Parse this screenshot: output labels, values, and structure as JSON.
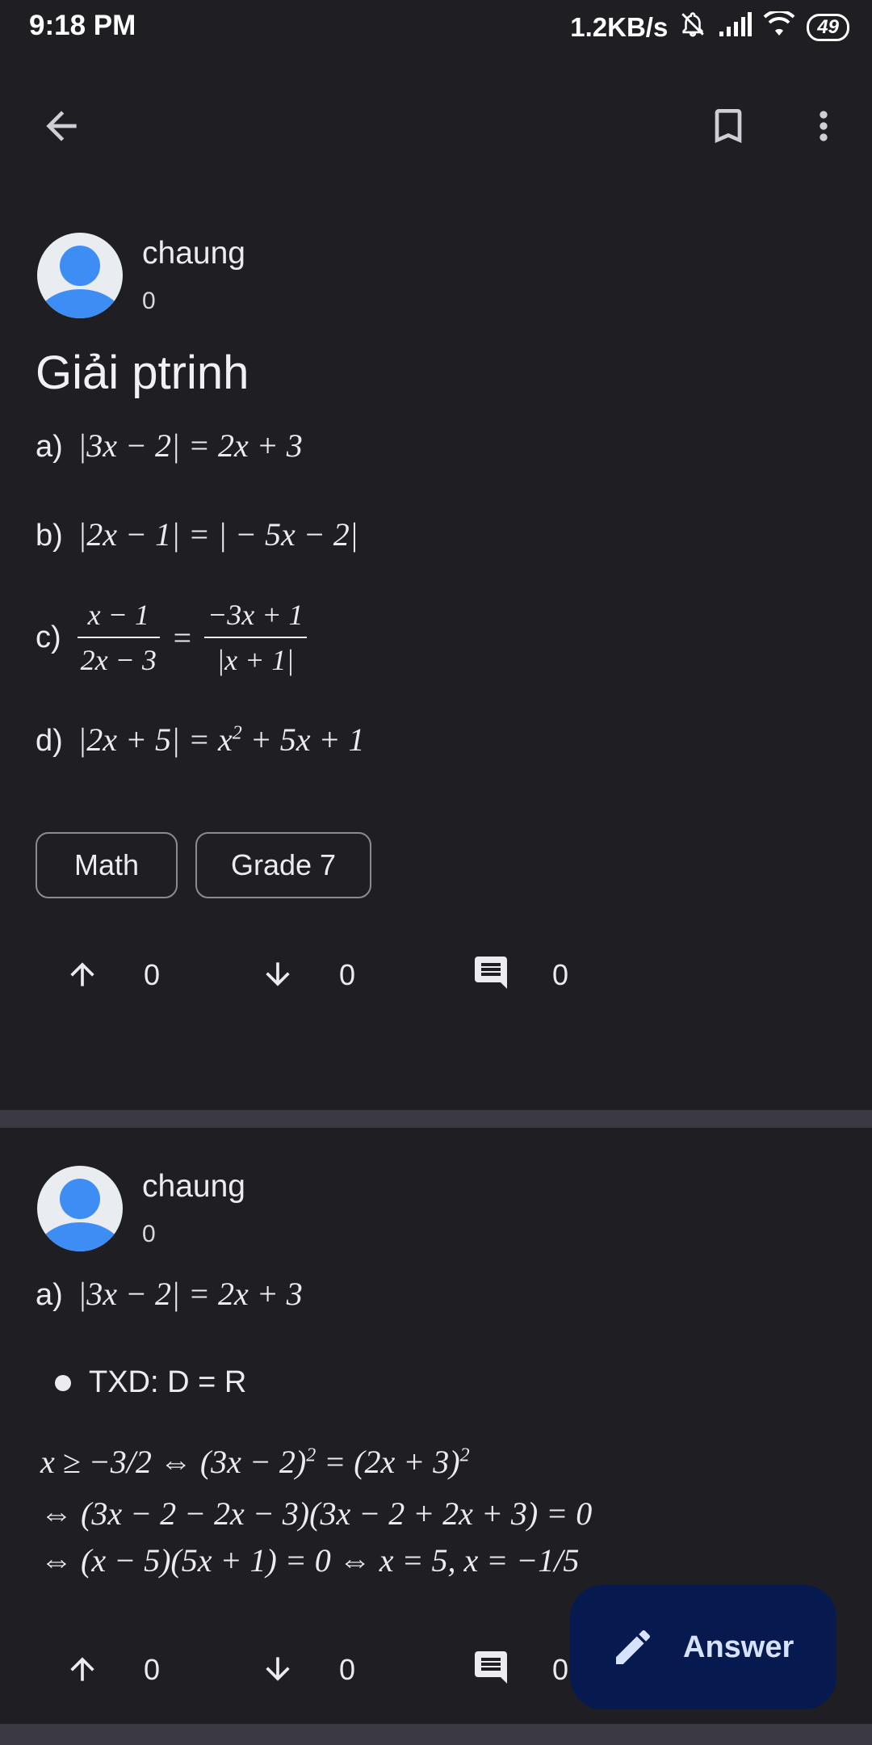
{
  "status_bar": {
    "time": "9:18 PM",
    "network_speed": "1.2KB/s",
    "battery": "49",
    "icons": [
      "mute-icon",
      "signal-icon",
      "wifi-icon",
      "battery-icon"
    ]
  },
  "toolbar": {
    "icons": [
      "back-arrow-icon",
      "bookmark-icon",
      "more-vert-icon"
    ]
  },
  "question": {
    "author": "chaung",
    "author_score": "0",
    "title": "Giải ptrinh",
    "parts": {
      "a_label": "a)",
      "a_expr": "|3x − 2| = 2x + 3",
      "b_label": "b)",
      "b_expr": "|2x − 1| = | − 5x − 2|",
      "c_label": "c)",
      "c_num_left": "x − 1",
      "c_den_left": "2x − 3",
      "c_eq": "=",
      "c_num_right": "−3x + 1",
      "c_den_right": "|x + 1|",
      "d_label": "d)",
      "d_expr_pre": "|2x + 5| = x",
      "d_exp": "2",
      "d_expr_post": " + 5x + 1"
    },
    "tags": [
      "Math",
      "Grade 7"
    ],
    "upvotes": "0",
    "downvotes": "0",
    "comments": "0"
  },
  "answer": {
    "author": "chaung",
    "author_score": "0",
    "a_label": "a)",
    "a_expr": "|3x − 2| = 2x + 3",
    "bullet_text": "TXD: D = R",
    "line1_pre": "x ≥ −3/2  ⇔ (3x − 2)",
    "line1_exp1": "2",
    "line1_mid": " = (2x + 3)",
    "line1_exp2": "2",
    "line2": "⇔ (3x − 2 − 2x − 3)(3x − 2 + 2x + 3) = 0",
    "line3": "⇔ (x − 5)(5x + 1) = 0  ⇔ x = 5, x = −1/5",
    "upvotes": "0",
    "downvotes": "0",
    "comments": "0"
  },
  "fab": {
    "label": "Answer",
    "icon": "pencil-icon",
    "color": "#071a4f"
  }
}
